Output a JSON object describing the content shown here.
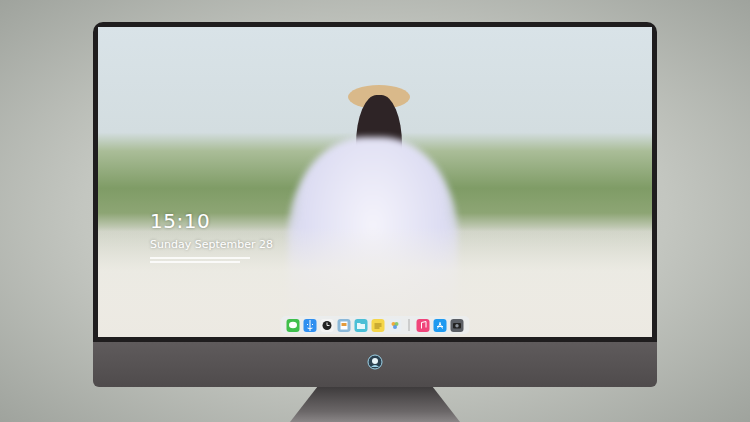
{
  "lock_screen": {
    "time": "15:10",
    "date": "Sunday September 28"
  },
  "dock": {
    "apps": [
      {
        "kind": "messages",
        "color": "#3fbf4c"
      },
      {
        "kind": "finder",
        "color": "#2f8ff0"
      },
      {
        "kind": "clock",
        "color": "#f4f4f4"
      },
      {
        "kind": "preview",
        "color": "#8bb8d8"
      },
      {
        "kind": "files",
        "color": "#4bbfd6"
      },
      {
        "kind": "notes",
        "color": "#f5d64a"
      },
      {
        "kind": "photos",
        "color": "#e9eef2"
      }
    ],
    "extras": [
      {
        "kind": "music",
        "color": "#f0457a"
      },
      {
        "kind": "appstore",
        "color": "#1e9af0"
      },
      {
        "kind": "camera",
        "color": "#5b5f66"
      }
    ]
  }
}
